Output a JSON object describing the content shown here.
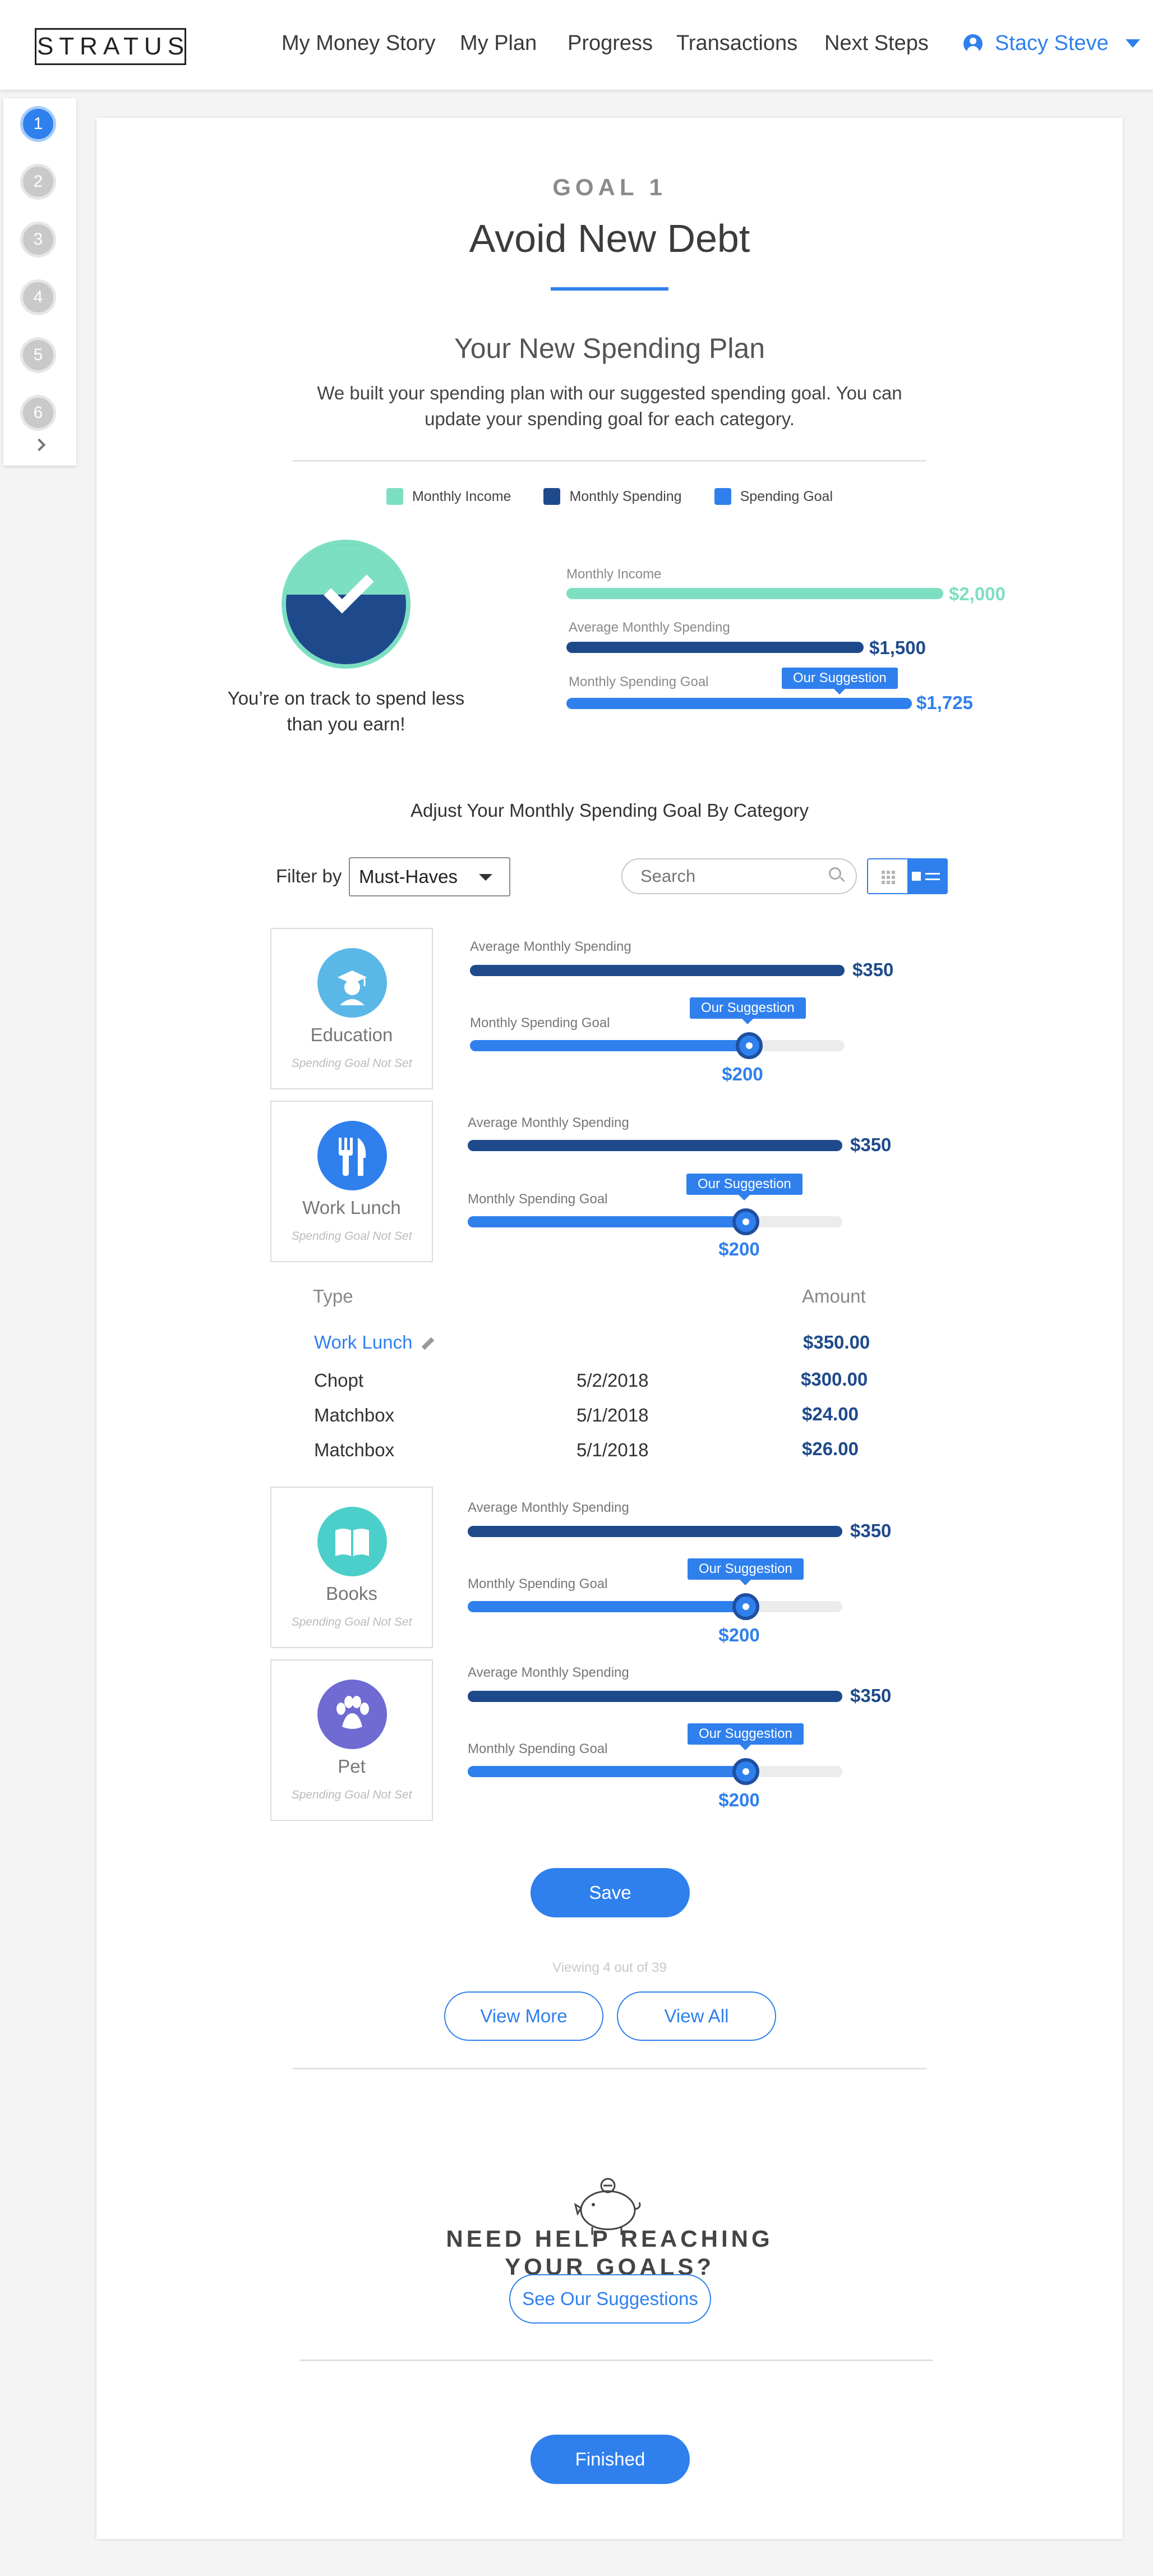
{
  "header": {
    "logo": "STRATUS",
    "nav": [
      "My Money Story",
      "My Plan",
      "Progress",
      "Transactions",
      "Next Steps"
    ],
    "user_name": "Stacy Steve"
  },
  "stepper": {
    "steps": [
      "1",
      "2",
      "3",
      "4",
      "5",
      "6"
    ],
    "active": 1
  },
  "goal": {
    "label": "GOAL 1",
    "title": "Avoid New Debt",
    "plan_title": "Your New Spending Plan",
    "plan_desc": "We built your spending plan with our suggested spending goal. You can update your spending goal for each category."
  },
  "legend": [
    "Monthly Income",
    "Monthly Spending",
    "Spending Goal"
  ],
  "summary": {
    "status": "You’re on track to spend less than you earn!",
    "income_label": "Monthly Income",
    "income_value": "$2,000",
    "spending_label": "Average Monthly Spending",
    "spending_value": "$1,500",
    "goal_label": "Monthly Spending Goal",
    "goal_value": "$1,725",
    "suggestion_tag": "Our Suggestion"
  },
  "adjust": {
    "title": "Adjust Your Monthly Spending Goal By Category",
    "filter_label": "Filter by",
    "filter_value": "Must-Haves",
    "search_placeholder": "Search"
  },
  "categories": [
    {
      "name": "Education",
      "status": "Spending Goal Not Set",
      "avg_label": "Average Monthly Spending",
      "avg_value": "$350",
      "goal_label": "Monthly Spending Goal",
      "goal_value": "$200",
      "suggestion": "Our Suggestion"
    },
    {
      "name": "Work Lunch",
      "status": "Spending Goal Not Set",
      "avg_label": "Average Monthly Spending",
      "avg_value": "$350",
      "goal_label": "Monthly Spending Goal",
      "goal_value": "$200",
      "suggestion": "Our Suggestion"
    },
    {
      "name": "Books",
      "status": "Spending Goal Not Set",
      "avg_label": "Average Monthly Spending",
      "avg_value": "$350",
      "goal_label": "Monthly Spending Goal",
      "goal_value": "$200",
      "suggestion": "Our Suggestion"
    },
    {
      "name": "Pet",
      "status": "Spending Goal Not Set",
      "avg_label": "Average Monthly Spending",
      "avg_value": "$350",
      "goal_label": "Monthly Spending Goal",
      "goal_value": "$200",
      "suggestion": "Our Suggestion"
    }
  ],
  "transactions": {
    "head_type": "Type",
    "head_amount": "Amount",
    "group_name": "Work Lunch",
    "group_total": "$350.00",
    "rows": [
      {
        "merchant": "Chopt",
        "date": "5/2/2018",
        "amount": "$300.00"
      },
      {
        "merchant": "Matchbox",
        "date": "5/1/2018",
        "amount": "$24.00"
      },
      {
        "merchant": "Matchbox",
        "date": "5/1/2018",
        "amount": "$26.00"
      }
    ]
  },
  "actions": {
    "save": "Save",
    "viewing": "Viewing 4 out of 39",
    "view_more": "View More",
    "view_all": "View All"
  },
  "help": {
    "title_line1": "NEED HELP REACHING",
    "title_line2": "YOUR GOALS?",
    "button": "See Our Suggestions",
    "finished": "Finished"
  },
  "colors": {
    "accent": "#2f80ed",
    "income": "#7ddfc2",
    "spending": "#1e4a8c",
    "goal": "#2f80ed"
  }
}
